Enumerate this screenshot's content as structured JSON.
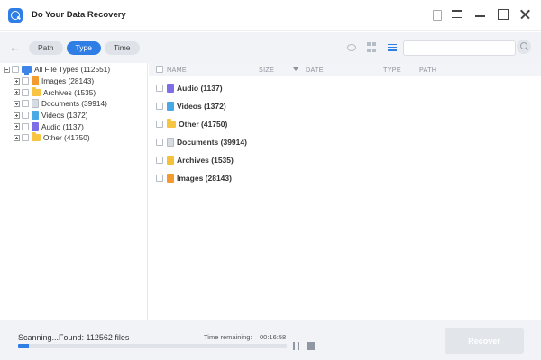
{
  "window": {
    "title": "Do Your Data Recovery"
  },
  "toolbar": {
    "back_icon": "back-arrow-icon",
    "tabs": [
      {
        "label": "Path",
        "active": false
      },
      {
        "label": "Type",
        "active": true
      },
      {
        "label": "Time",
        "active": false
      }
    ],
    "view_icons": [
      "eye-icon",
      "grid-view-icon",
      "list-view-icon"
    ],
    "search_placeholder": ""
  },
  "tree": {
    "root": {
      "label": "All File Types (112551)",
      "icon": "computer-icon"
    },
    "items": [
      {
        "label": "Images (28143)",
        "icon": "image-file-icon"
      },
      {
        "label": "Archives (1535)",
        "icon": "folder-icon"
      },
      {
        "label": "Documents (39914)",
        "icon": "document-icon"
      },
      {
        "label": "Videos (1372)",
        "icon": "video-file-icon"
      },
      {
        "label": "Audio (1137)",
        "icon": "audio-file-icon"
      },
      {
        "label": "Other (41750)",
        "icon": "folder-icon"
      }
    ]
  },
  "file_list": {
    "columns": {
      "name": "NAME",
      "size": "SIZE",
      "date": "DATE",
      "type": "TYPE",
      "path": "PATH"
    },
    "rows": [
      {
        "label": "Audio (1137)",
        "icon": "audio-file-icon"
      },
      {
        "label": "Videos (1372)",
        "icon": "video-file-icon"
      },
      {
        "label": "Other (41750)",
        "icon": "folder-icon"
      },
      {
        "label": "Documents (39914)",
        "icon": "document-icon"
      },
      {
        "label": "Archives (1535)",
        "icon": "archive-file-icon"
      },
      {
        "label": "Images (28143)",
        "icon": "image-file-icon"
      }
    ]
  },
  "status": {
    "scan_text": "Scanning...Found: 112562 files",
    "time_label": "Time remaining:",
    "time_value": "00:16:58",
    "progress_fraction": 0.04,
    "recover_label": "Recover"
  },
  "colors": {
    "accent": "#2f7ee6",
    "toolbar_bg": "#f1f3f7",
    "recover_disabled": "#e2e5ea"
  }
}
